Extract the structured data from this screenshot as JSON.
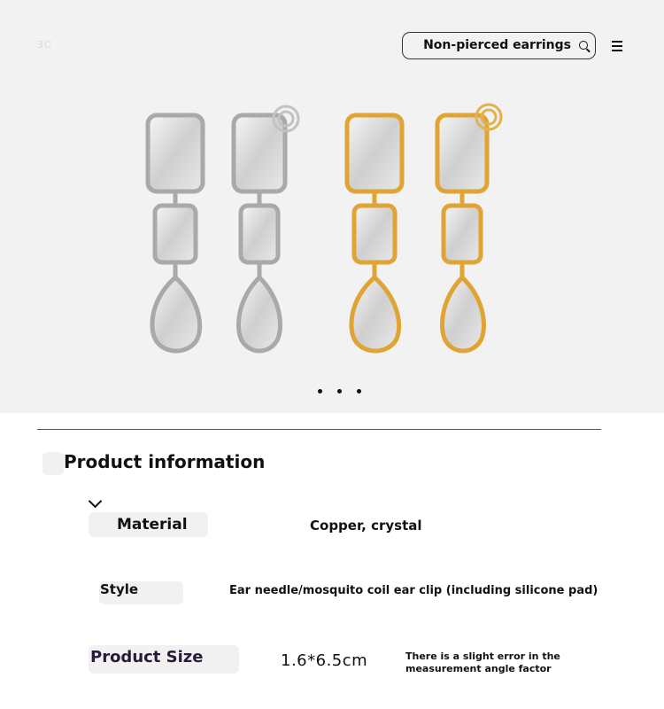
{
  "header": {
    "logo_text": "3C",
    "search_value": "Non-pierced earrings",
    "icons": {
      "search": "search-icon",
      "menu": "menu-icon"
    }
  },
  "hero": {
    "image_description": "earrings-product-photo",
    "carousel_count": 3,
    "carousel_active": 0
  },
  "product_info": {
    "title": "Product information",
    "toggle_icon": "chevron-down-icon",
    "specs": [
      {
        "label": "Material",
        "value": "Copper, crystal"
      },
      {
        "label": "Style",
        "value": "Ear needle/mosquito coil ear clip (including silicone pad)"
      },
      {
        "label": "Product Size",
        "value": "1.6*6.5cm",
        "note": "There is a slight error in the measurement angle factor"
      }
    ]
  },
  "colors": {
    "hero_bg": "#f2f2f2",
    "silver": "#b9b9b9",
    "gold": "#e0a832",
    "text": "#111111"
  }
}
